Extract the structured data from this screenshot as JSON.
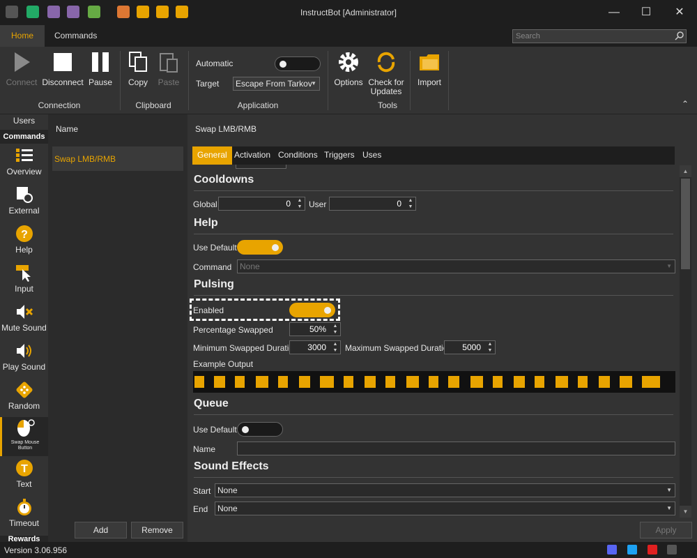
{
  "window": {
    "title": "InstructBot [Administrator]"
  },
  "ribbon_tabs": [
    {
      "label": "Home"
    },
    {
      "label": "Commands"
    }
  ],
  "search": {
    "placeholder": "Search"
  },
  "ribbon": {
    "connect": "Connect",
    "disconnect": "Disconnect",
    "pause": "Pause",
    "copy": "Copy",
    "paste": "Paste",
    "automatic": "Automatic",
    "target": "Target",
    "target_value": "Escape From Tarkov",
    "options": "Options",
    "check_updates_1": "Check for",
    "check_updates_2": "Updates",
    "import": "Import",
    "groups": {
      "connection": "Connection",
      "clipboard": "Clipboard",
      "application": "Application",
      "tools": "Tools"
    }
  },
  "nav": {
    "users": "Users",
    "commands": "Commands",
    "rewards": "Rewards",
    "items": [
      {
        "label": "Overview"
      },
      {
        "label": "External"
      },
      {
        "label": "Help"
      },
      {
        "label": "Input"
      },
      {
        "label": "Mute Sound"
      },
      {
        "label": "Play Sound"
      },
      {
        "label": "Random"
      },
      {
        "label": "Swap Mouse Button"
      },
      {
        "label": "Text"
      },
      {
        "label": "Timeout"
      }
    ]
  },
  "list": {
    "header": "Name",
    "items": [
      "Swap LMB/RMB"
    ],
    "add": "Add",
    "remove": "Remove"
  },
  "detail": {
    "title": "Swap LMB/RMB",
    "tabs": [
      "General",
      "Activation",
      "Conditions",
      "Triggers",
      "Uses"
    ],
    "cooldowns": {
      "title": "Cooldowns",
      "global": "Global",
      "global_value": "0",
      "user": "User",
      "user_value": "0"
    },
    "help": {
      "title": "Help",
      "use_default": "Use Default",
      "command": "Command",
      "command_placeholder": "None"
    },
    "pulsing": {
      "title": "Pulsing",
      "enabled": "Enabled",
      "pct": "Percentage Swapped",
      "pct_value": "50%",
      "min": "Minimum Swapped Duration",
      "min_value": "3000",
      "max": "Maximum Swapped Duration",
      "max_value": "5000",
      "example": "Example Output"
    },
    "queue": {
      "title": "Queue",
      "use_default": "Use Default",
      "name": "Name"
    },
    "sound": {
      "title": "Sound Effects",
      "start": "Start",
      "start_value": "None",
      "end": "End",
      "end_value": "None"
    },
    "apply": "Apply"
  },
  "status": {
    "version": "Version 3.06.956"
  },
  "colors": {
    "accent": "#e8a400",
    "bg": "#333333"
  }
}
